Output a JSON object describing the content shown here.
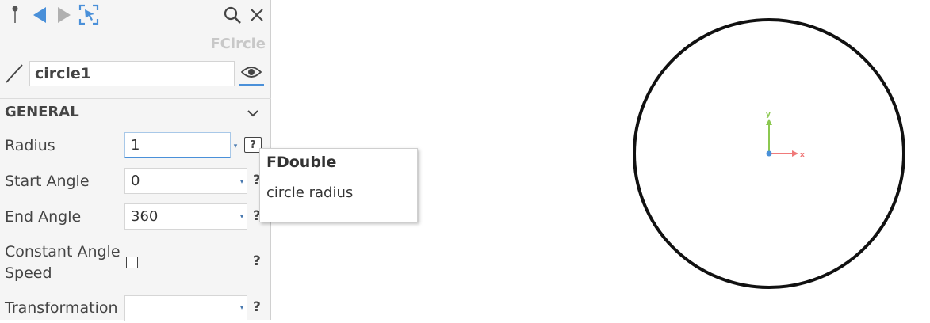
{
  "toolbar": {
    "pin": "pin-icon",
    "back": "back-arrow-icon",
    "forward": "forward-arrow-icon",
    "select": "select-target-icon",
    "search": "search-icon",
    "close": "close-icon"
  },
  "object": {
    "class_name": "FCircle",
    "name": "circle1"
  },
  "section": {
    "title": "GENERAL"
  },
  "properties": [
    {
      "label": "Radius",
      "value": "1"
    },
    {
      "label": "Start Angle",
      "value": "0"
    },
    {
      "label": "End Angle",
      "value": "360"
    },
    {
      "label": "Constant Angle",
      "label2": "Speed",
      "checked": false
    },
    {
      "label": "Transformation",
      "value": ""
    }
  ],
  "help_symbol": "?",
  "tooltip": {
    "title": "FDouble",
    "body": "circle radius"
  },
  "viewport": {
    "axis_x": "x",
    "axis_y": "y",
    "axis_x_color": "#f07a7a",
    "axis_y_color": "#8cc850",
    "origin_color": "#4a90d9",
    "accent": "#4a90d9"
  }
}
